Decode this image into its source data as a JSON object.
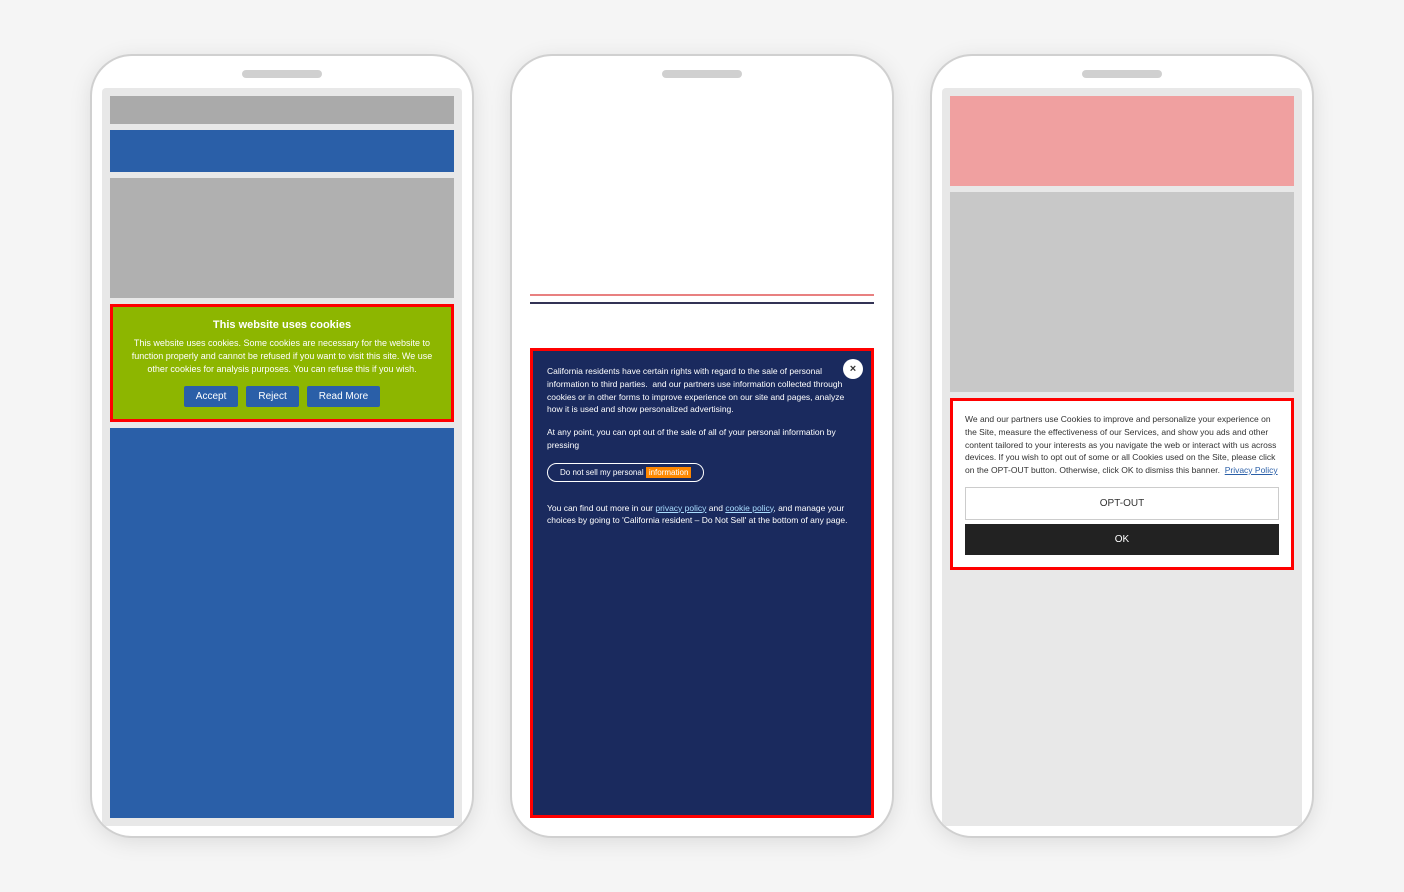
{
  "background_color": "#f5f5f5",
  "phone1": {
    "cookie_banner": {
      "title": "This website uses cookies",
      "body": "This website uses cookies. Some cookies are necessary for the website to function properly and cannot be refused if you want to visit this site. We use other cookies for analysis purposes. You can refuse this if you wish.",
      "accept_label": "Accept",
      "reject_label": "Reject",
      "read_more_label": "Read More"
    }
  },
  "phone2": {
    "california_banner": {
      "body1": "California residents have certain rights with regard to the sale of personal information to third parties.",
      "body2": "and our partners use information collected through cookies or in other forms to improve experience on our site and pages, analyze how it is used and show personalized advertising.",
      "body3": "At any point, you can opt out of the sale of all of your personal information by pressing",
      "do_not_sell_label": "Do not sell my personal information",
      "do_not_sell_highlight": "information",
      "body4": "You can find out more in our",
      "privacy_policy_label": "privacy policy",
      "body5": "and",
      "cookie_policy_label": "cookie policy",
      "body6": ", and manage your choices by going to 'California resident – Do Not Sell' at the bottom of any page.",
      "close_icon": "×"
    }
  },
  "phone3": {
    "gdpr_banner": {
      "body": "We and our partners use Cookies to improve and personalize your experience on the Site, measure the effectiveness of our Services, and show you ads and other content tailored to your interests as you navigate the web or interact with us across devices. If you wish to opt out of some or all Cookies used on the Site, please click on the OPT-OUT button. Otherwise, click OK to dismiss this banner.",
      "privacy_policy_label": "Privacy Policy",
      "opt_out_label": "OPT-OUT",
      "ok_label": "OK"
    }
  }
}
